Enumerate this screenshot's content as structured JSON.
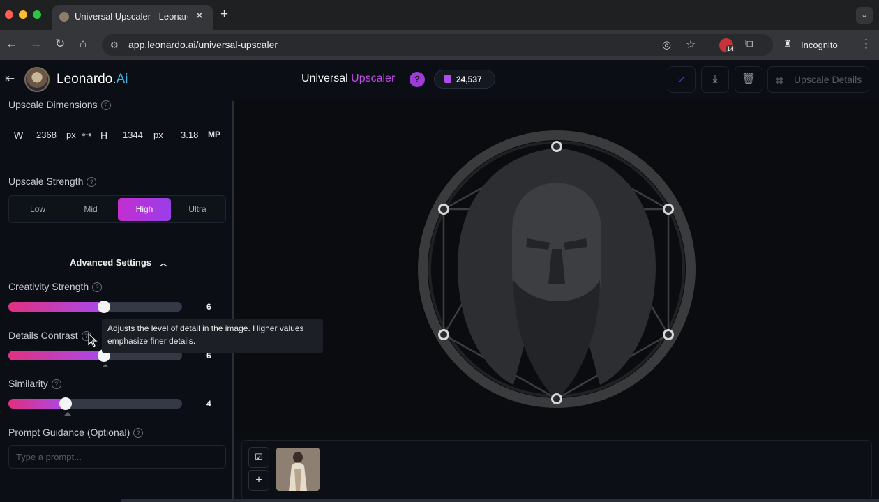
{
  "browser": {
    "tab_title": "Universal Upscaler - Leonardo.Ai",
    "url": "app.leonardo.ai/universal-upscaler",
    "incognito_label": "Incognito",
    "extension_badge": "14"
  },
  "header": {
    "brand_main": "Leonardo.",
    "brand_ai": "Ai",
    "title_main": "Universal",
    "title_accent": "Upscaler",
    "help": "?",
    "tokens": "24,537",
    "upscale_details_label": "Upscale Details"
  },
  "dimensions": {
    "label": "Upscale Dimensions",
    "w_label": "W",
    "width": "2368",
    "w_unit": "px",
    "h_label": "H",
    "height": "1344",
    "h_unit": "px",
    "megapixels": "3.18",
    "mp_unit": "MP"
  },
  "strength": {
    "label": "Upscale Strength",
    "options": [
      "Low",
      "Mid",
      "High",
      "Ultra"
    ],
    "selected": "High"
  },
  "advanced": {
    "label": "Advanced Settings"
  },
  "sliders": [
    {
      "label": "Creativity Strength",
      "value": "6",
      "fraction": 0.55
    },
    {
      "label": "Details Contrast",
      "value": "6",
      "fraction": 0.55
    },
    {
      "label": "Similarity",
      "value": "4",
      "fraction": 0.33
    }
  ],
  "tooltip": "Adjusts the level of detail in the image. Higher values emphasize finer details.",
  "prompt": {
    "label": "Prompt Guidance (Optional)",
    "placeholder": "Type a prompt..."
  },
  "colors": {
    "accent": "#c14ce8",
    "slider_start": "#e0307f",
    "slider_end": "#a64bf4"
  }
}
